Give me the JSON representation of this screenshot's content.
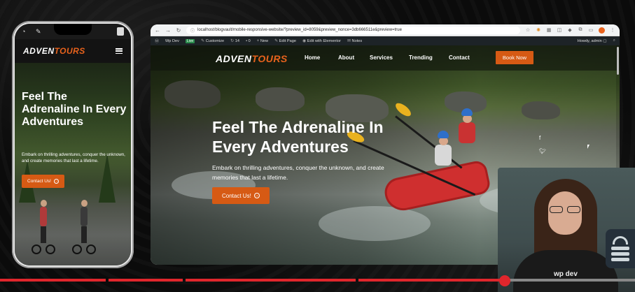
{
  "phone": {
    "brand_left": "ADVEN",
    "brand_right": "TOURS",
    "hero_title": "Feel The Adrenaline In Every Adventures",
    "hero_text": "Embark on thrilling adventures, conquer the unknown, and create memories that last a lifetime.",
    "cta": "Contact Us!"
  },
  "browser": {
    "url": "localhost/blogvault/mobile-responsive-website/?preview_id=8059&preview_nonce=3db666511e&preview=true",
    "wp_bar": {
      "site": "Wp Dev",
      "live": "Live",
      "customize": "Customize",
      "updates": "14",
      "comments": "0",
      "new": "New",
      "edit_page": "Edit Page",
      "edit_elementor": "Edit with Elementor",
      "notes": "Notes",
      "howdy": "Howdy, admin"
    }
  },
  "site": {
    "brand_left": "ADVEN",
    "brand_right": "TOURS",
    "menu": [
      "Home",
      "About",
      "Services",
      "Trending",
      "Contact"
    ],
    "book_now": "Book Now",
    "hero_title": "Feel The Adrenaline In Every Adventures",
    "hero_text": "Embark on thrilling adventures, conquer the unknown, and create memories that last a lifetime.",
    "cta": "Contact Us!",
    "social": [
      "facebook-icon",
      "twitter-icon"
    ]
  },
  "webcam": {
    "shirt_text": "wp dev"
  },
  "colors": {
    "accent": "#d65a14",
    "brand_orange": "#e8621c",
    "timeline_red": "#e0262c"
  },
  "timeline": {
    "progress": 0.79
  }
}
